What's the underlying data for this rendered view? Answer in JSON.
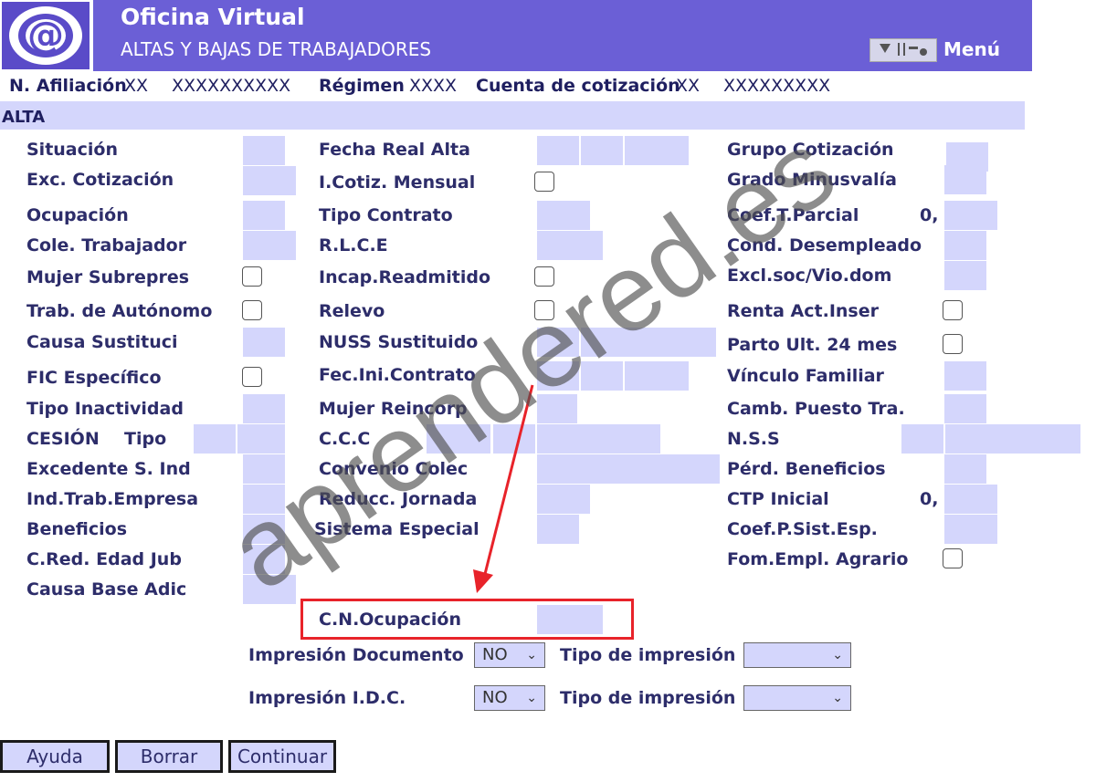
{
  "header": {
    "title": "Oficina Virtual",
    "subtitle": "ALTAS Y BAJAS DE TRABAJADORES",
    "menu_label": "Menú",
    "logo_text": "@"
  },
  "info": {
    "afiliacion_label": "N. Afiliación",
    "afiliacion_a": "XX",
    "afiliacion_b": "XXXXXXXXXX",
    "regimen_label": "Régimen",
    "regimen_value": "XXXX",
    "cuenta_label": "Cuenta de cotización",
    "cuenta_a": "XX",
    "cuenta_b": "XXXXXXXXX"
  },
  "section": {
    "label": "ALTA"
  },
  "labels": {
    "situacion": "Situación",
    "exc_cotizacion": "Exc. Cotización",
    "ocupacion": "Ocupación",
    "cole_trabajador": "Cole. Trabajador",
    "mujer_subrepres": "Mujer Subrepres",
    "trab_autonomo": "Trab. de Autónomo",
    "causa_sustituci": "Causa Sustituci",
    "fic_especifico": "FIC Específico",
    "tipo_inactividad": "Tipo Inactividad",
    "cesion": "CESIÓN",
    "tipo": "Tipo",
    "excedente": "Excedente S. Ind",
    "ind_trab_empresa": "Ind.Trab.Empresa",
    "beneficios": "Beneficios",
    "c_red_edad": "C.Red. Edad Jub",
    "causa_base": "Causa Base Adic",
    "fecha_real_alta": "Fecha Real Alta",
    "icotiz_mensual": "I.Cotiz. Mensual",
    "tipo_contrato": "Tipo Contrato",
    "rlce": "R.L.C.E",
    "incap_readmitido": "Incap.Readmitido",
    "relevo": "Relevo",
    "nuss_sustituido": "NUSS Sustituido",
    "fec_ini_contrato": "Fec.Ini.Contrato",
    "mujer_reincorp": "Mujer Reincorp",
    "ccc": "C.C.C",
    "convenio_colec": "Convenio Colec",
    "reducc_jornada": "Reducc. Jornada",
    "sistema_especial": "Sistema Especial",
    "cn_ocupacion": "C.N.Ocupación",
    "grupo_cotizacion": "Grupo Cotización",
    "grado_minusvalia": "Grado Minusvalía",
    "coef_t_parcial": "Coef.T.Parcial",
    "cond_desempleado": "Cond. Desempleado",
    "excl_soc": "Excl.soc/Vio.dom",
    "renta_act_inser": "Renta Act.Inser",
    "parto_ult": "Parto Ult. 24 mes",
    "vinculo_familiar": "Vínculo Familiar",
    "camb_puesto": "Camb. Puesto Tra.",
    "nss": "N.S.S",
    "perd_beneficios": "Pérd. Beneficios",
    "ctp_inicial": "CTP Inicial",
    "coef_p_sist": "Coef.P.Sist.Esp.",
    "fom_empl_agrario": "Fom.Empl. Agrario"
  },
  "values": {
    "coef_t_parcial_prefix": "0,",
    "ctp_inicial_prefix": "0,"
  },
  "print": {
    "impresion_documento": "Impresión Documento",
    "impresion_idc": "Impresión I.D.C.",
    "tipo_impresion_1": "Tipo de impresión",
    "tipo_impresion_2": "Tipo de impresión",
    "doc_select_value": "NO",
    "idc_select_value": "NO",
    "tipo_select_1_value": "",
    "tipo_select_2_value": ""
  },
  "buttons": {
    "ayuda": "Ayuda",
    "borrar": "Borrar",
    "continuar": "Continuar"
  },
  "watermark": "aprendered.es",
  "colors": {
    "header_bg": "#6b5fd6",
    "field_bg": "#d4d6fc",
    "label_text": "#2d2d6a",
    "highlight": "#e8232a"
  }
}
